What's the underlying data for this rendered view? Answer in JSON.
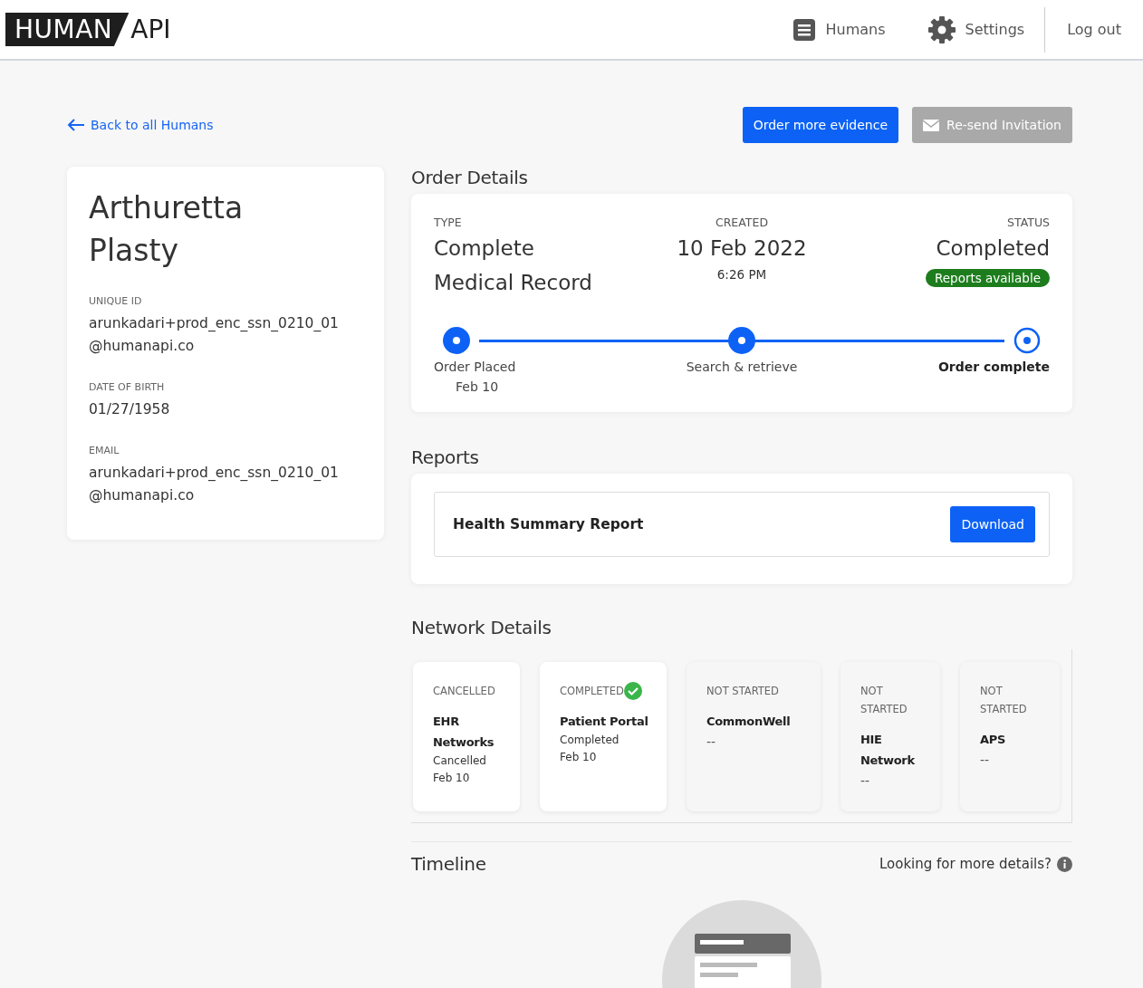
{
  "logo": {
    "boxed": "HUMAN",
    "plain": "API"
  },
  "nav": [
    {
      "kind": "list",
      "label": "Humans"
    },
    {
      "kind": "gear",
      "label": "Settings"
    },
    {
      "kind": "plain",
      "label": "Log out"
    }
  ],
  "back_link": "Back to all Humans",
  "actions": [
    {
      "label": "Order more evidence",
      "disabled": false
    },
    {
      "label": "Re-send Invitation",
      "disabled": true
    }
  ],
  "human": {
    "name": "Arthuretta Plasty",
    "fields": [
      {
        "label": "UNIQUE ID",
        "value": "arunkadari+prod_enc_ssn_0210_01 @humanapi.co"
      },
      {
        "label": "DATE OF BIRTH",
        "value": "01/27/1958"
      },
      {
        "label": "EMAIL",
        "value": "arunkadari+prod_enc_ssn_0210_01 @humanapi.co"
      }
    ]
  },
  "order_details": {
    "title": "Order Details",
    "type_label": "TYPE",
    "type": "Complete Medical Record",
    "created_label": "CREATED",
    "created_date": "10 Feb 2022",
    "created_time": "6:26 PM",
    "status_label": "STATUS",
    "status": "Completed",
    "status_badge": "Reports available",
    "steps": [
      {
        "label": "Order Placed",
        "date": "Feb 10",
        "current": false
      },
      {
        "label": "Search & retrieve",
        "current": false
      },
      {
        "label": "Order complete",
        "current": true
      }
    ]
  },
  "reports": {
    "title": "Reports",
    "items": [
      {
        "name": "Health Summary Report",
        "action": "Download"
      }
    ]
  },
  "network": {
    "title": "Network Details",
    "cards": [
      {
        "kind": "cancelled",
        "status": "CANCELLED",
        "name": "EHR Networks",
        "detail": "Cancelled",
        "date": "Feb 10"
      },
      {
        "kind": "completed",
        "status": "COMPLETED",
        "name": "Patient Portal",
        "detail": "Completed",
        "date": "Feb 10"
      },
      {
        "kind": "not_started",
        "status": "NOT STARTED",
        "name": "CommonWell",
        "detail": "--"
      },
      {
        "kind": "not_started",
        "status": "NOT STARTED",
        "name": "HIE Network",
        "detail": "--"
      },
      {
        "kind": "not_started",
        "status": "NOT STARTED",
        "name": "APS",
        "detail": "--"
      }
    ]
  },
  "timeline": {
    "title": "Timeline",
    "help": "Looking for more details?"
  }
}
